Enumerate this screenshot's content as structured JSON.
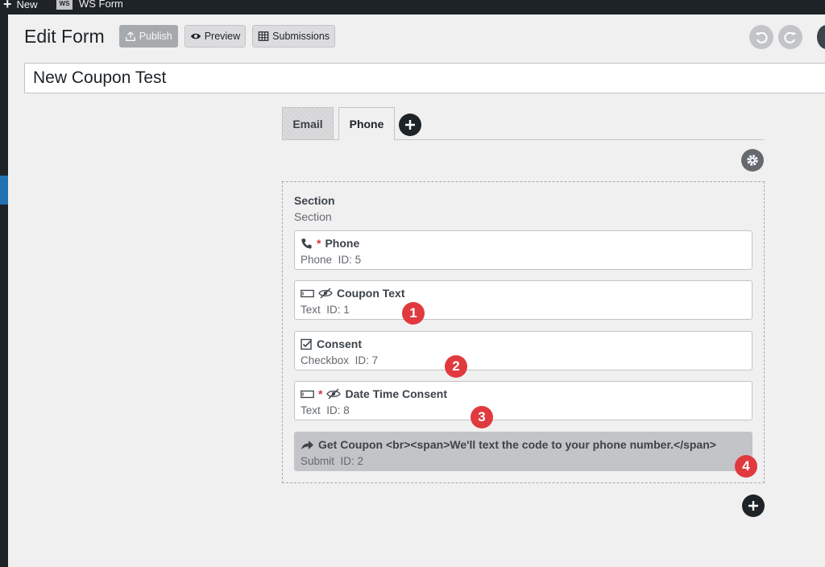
{
  "admin_bar": {
    "new_label": "New",
    "ws_logo": "WS",
    "ws_label": "WS Form"
  },
  "header": {
    "title": "Edit Form",
    "publish_label": "Publish",
    "preview_label": "Preview",
    "submissions_label": "Submissions"
  },
  "form": {
    "title": "New Coupon Test"
  },
  "tabs": [
    {
      "label": "Email",
      "active": false
    },
    {
      "label": "Phone",
      "active": true
    }
  ],
  "section": {
    "title": "Section",
    "subtitle": "Section",
    "fields": [
      {
        "icon": "phone-icon",
        "required": true,
        "hidden": false,
        "label": "Phone",
        "type": "Phone",
        "id": "ID: 5"
      },
      {
        "icon": "text-input-icon",
        "required": false,
        "hidden": true,
        "label": "Coupon Text",
        "type": "Text",
        "id": "ID: 1"
      },
      {
        "icon": "checkbox-icon",
        "required": false,
        "hidden": false,
        "label": "Consent",
        "type": "Checkbox",
        "id": "ID: 7"
      },
      {
        "icon": "text-input-icon",
        "required": true,
        "hidden": true,
        "label": "Date Time Consent",
        "type": "Text",
        "id": "ID: 8"
      },
      {
        "icon": "share-arrow-icon",
        "required": false,
        "hidden": false,
        "label": "Get Coupon <br><span>We'll text the code to your phone number.</span>",
        "type": "Submit",
        "id": "ID: 2"
      }
    ]
  },
  "markers": [
    "1",
    "2",
    "3",
    "4"
  ],
  "required_mark": "*",
  "colors": {
    "accent": "#2271b1",
    "marker": "#e03a3e",
    "dark": "#1d2327",
    "required": "#d63638"
  }
}
